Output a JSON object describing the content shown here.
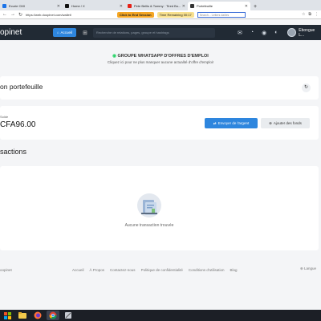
{
  "browser": {
    "tabs": [
      {
        "label": "Ecurie CMI"
      },
      {
        "label": "Home / X"
      },
      {
        "label": "Pete Bellis & Tommy · Tired Bo..."
      },
      {
        "label": "Portefeuille"
      }
    ],
    "url": "https://web.doopinet.com/wallet/",
    "extensions": {
      "session": "Click to End Session",
      "time": "Time Remaining 00:17",
      "search_placeholder": "Search... Letters dailies"
    }
  },
  "app": {
    "logo": "opinet",
    "home_label": "Accueil",
    "search_placeholder": "Recherche de relations, pages, groupe et hashtags",
    "user_name": "Ebongue L..."
  },
  "banner": {
    "title": "GROUPE WHATSAPP D'OFFRES D'EMPLOI",
    "subtitle": "Cliquez ici pour ne plus manquer aucune actualité d'offre d'emploi!"
  },
  "wallet": {
    "title": "on portefeuille",
    "solde_label": "Solde",
    "solde_value": "CFA96.00",
    "send_label": "Envoyer de l'argent",
    "add_label": "Ajouter des fonds"
  },
  "transactions": {
    "title": "sactions",
    "empty_text": "Aucune transaction trouvée"
  },
  "footer": {
    "left": "oopinet",
    "links": [
      "Accueil",
      "À Propos",
      "Contactez-nous",
      "Politique de confidentialité",
      "Conditions d'utilisation",
      "Blog"
    ],
    "language": "Langue"
  },
  "colors": {
    "accent": "#2e86de",
    "header": "#212a34",
    "whatsapp": "#25d366"
  }
}
